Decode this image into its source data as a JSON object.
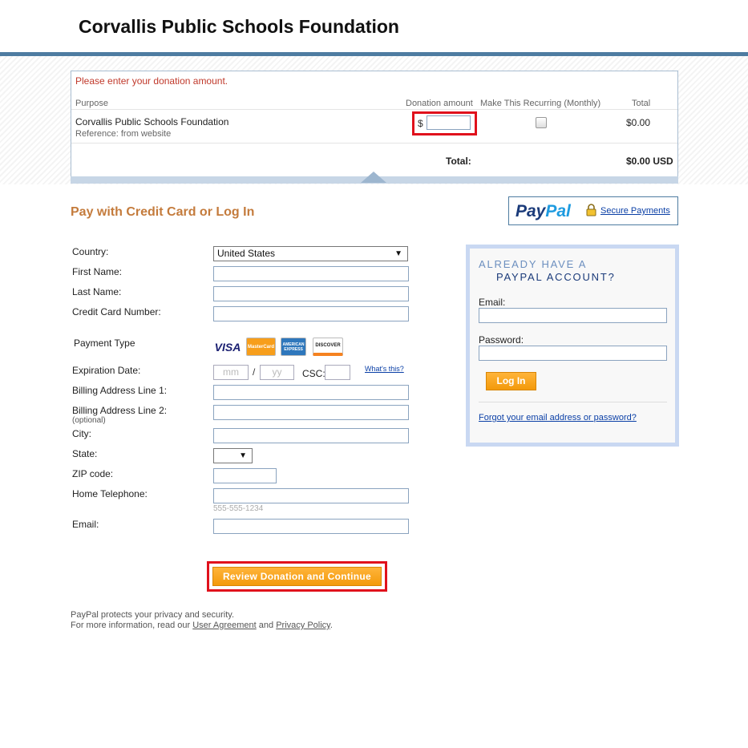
{
  "header": {
    "title": "Corvallis Public Schools Foundation"
  },
  "cart": {
    "error": "Please enter your donation amount.",
    "columns": {
      "purpose": "Purpose",
      "donation": "Donation amount",
      "recurring": "Make This Recurring (Monthly)",
      "total": "Total"
    },
    "item": {
      "name": "Corvallis Public Schools Foundation",
      "reference": "Reference: from website",
      "currency_symbol": "$",
      "amount_value": "",
      "total": "$0.00"
    },
    "total_label": "Total:",
    "total_value": "$0.00 USD"
  },
  "payment": {
    "title": "Pay with Credit Card or Log In",
    "paypal_logo": {
      "pay": "Pay",
      "pal": "Pal"
    },
    "secure_link": "Secure Payments",
    "fields": {
      "country_label": "Country:",
      "country_value": "United States",
      "first_name": "First Name:",
      "last_name": "Last Name:",
      "card_number": "Credit Card Number:",
      "payment_type": "Payment Type",
      "expiration": "Expiration Date:",
      "mm_placeholder": "mm",
      "slash": "/",
      "yy_placeholder": "yy",
      "csc": "CSC:",
      "whats_this": "What's this?",
      "billing1": "Billing Address Line 1:",
      "billing2": "Billing Address Line 2:",
      "optional": "(optional)",
      "city": "City:",
      "state": "State:",
      "zip": "ZIP code:",
      "phone": "Home Telephone:",
      "phone_hint": "555-555-1234",
      "email": "Email:"
    },
    "cards": [
      {
        "name": "VISA",
        "color": "#1a1f71"
      },
      {
        "name": "MasterCard",
        "color": "#eb001b"
      },
      {
        "name": "AMERICAN EXPRESS",
        "color": "#2e77bc"
      },
      {
        "name": "DISCOVER",
        "color": "#f58220"
      }
    ],
    "review_button": "Review Donation and Continue"
  },
  "footer": {
    "line1": "PayPal protects your privacy and security.",
    "line2_prefix": "For more information, read our",
    "user_agreement": "User Agreement",
    "and": "and",
    "privacy_policy": "Privacy Policy",
    "period": "."
  },
  "login": {
    "heading1": "ALREADY HAVE A",
    "heading2": "PAYPAL ACCOUNT?",
    "email_label": "Email:",
    "password_label": "Password:",
    "login_button": "Log In",
    "forgot_link": "Forgot your email address or password?"
  }
}
